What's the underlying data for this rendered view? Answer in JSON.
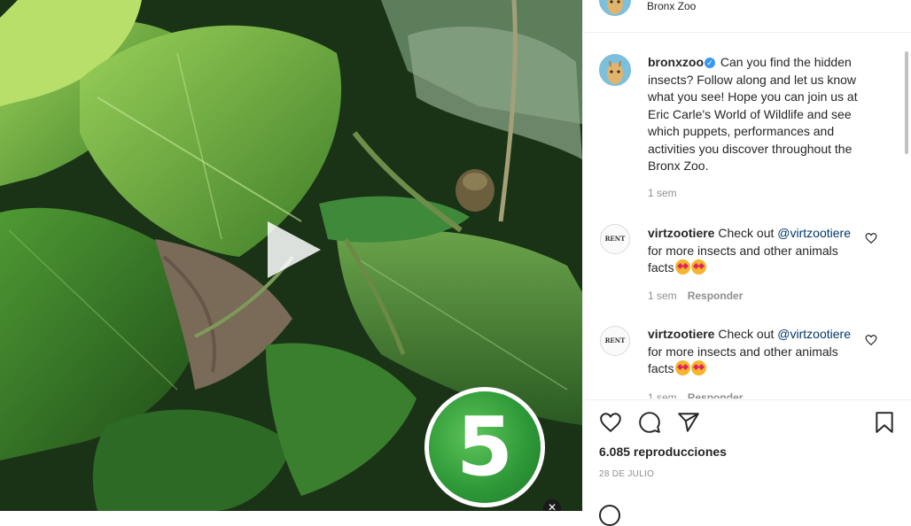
{
  "header": {
    "subtitle": "Bronx Zoo"
  },
  "post": {
    "username": "bronxzoo",
    "verified": true,
    "caption": "Can you find the hidden insects? Follow along and let us know what you see! Hope you can join us at Eric Carle's World of Wildlife and see which puppets, performances and activities you discover throughout the Bronx Zoo.",
    "time": "1 sem",
    "video_number": "5"
  },
  "comments": [
    {
      "username": "virtzootiere",
      "text_before": "Check out",
      "mention": "@virtzootiere",
      "text_after": "for more insects and other animals facts",
      "time": "1 sem",
      "reply_label": "Responder",
      "avatar_text": "RENT"
    },
    {
      "username": "virtzootiere",
      "text_before": "Check out",
      "mention": "@virtzootiere",
      "text_after": "for more insects and other animals facts",
      "time": "1 sem",
      "reply_label": "Responder",
      "avatar_text": "RENT"
    }
  ],
  "actions": {
    "views": "6.085 reproducciones",
    "date": "28 DE JULIO"
  },
  "icons": {
    "play": "play-icon",
    "like": "heart-icon",
    "comment": "comment-icon",
    "share": "share-icon",
    "save": "bookmark-icon",
    "verified": "verified-badge-icon"
  },
  "colors": {
    "verified": "#3897f0",
    "mention": "#00376b",
    "muted": "#8e8e8e",
    "badge_green": "#2f9a38"
  }
}
